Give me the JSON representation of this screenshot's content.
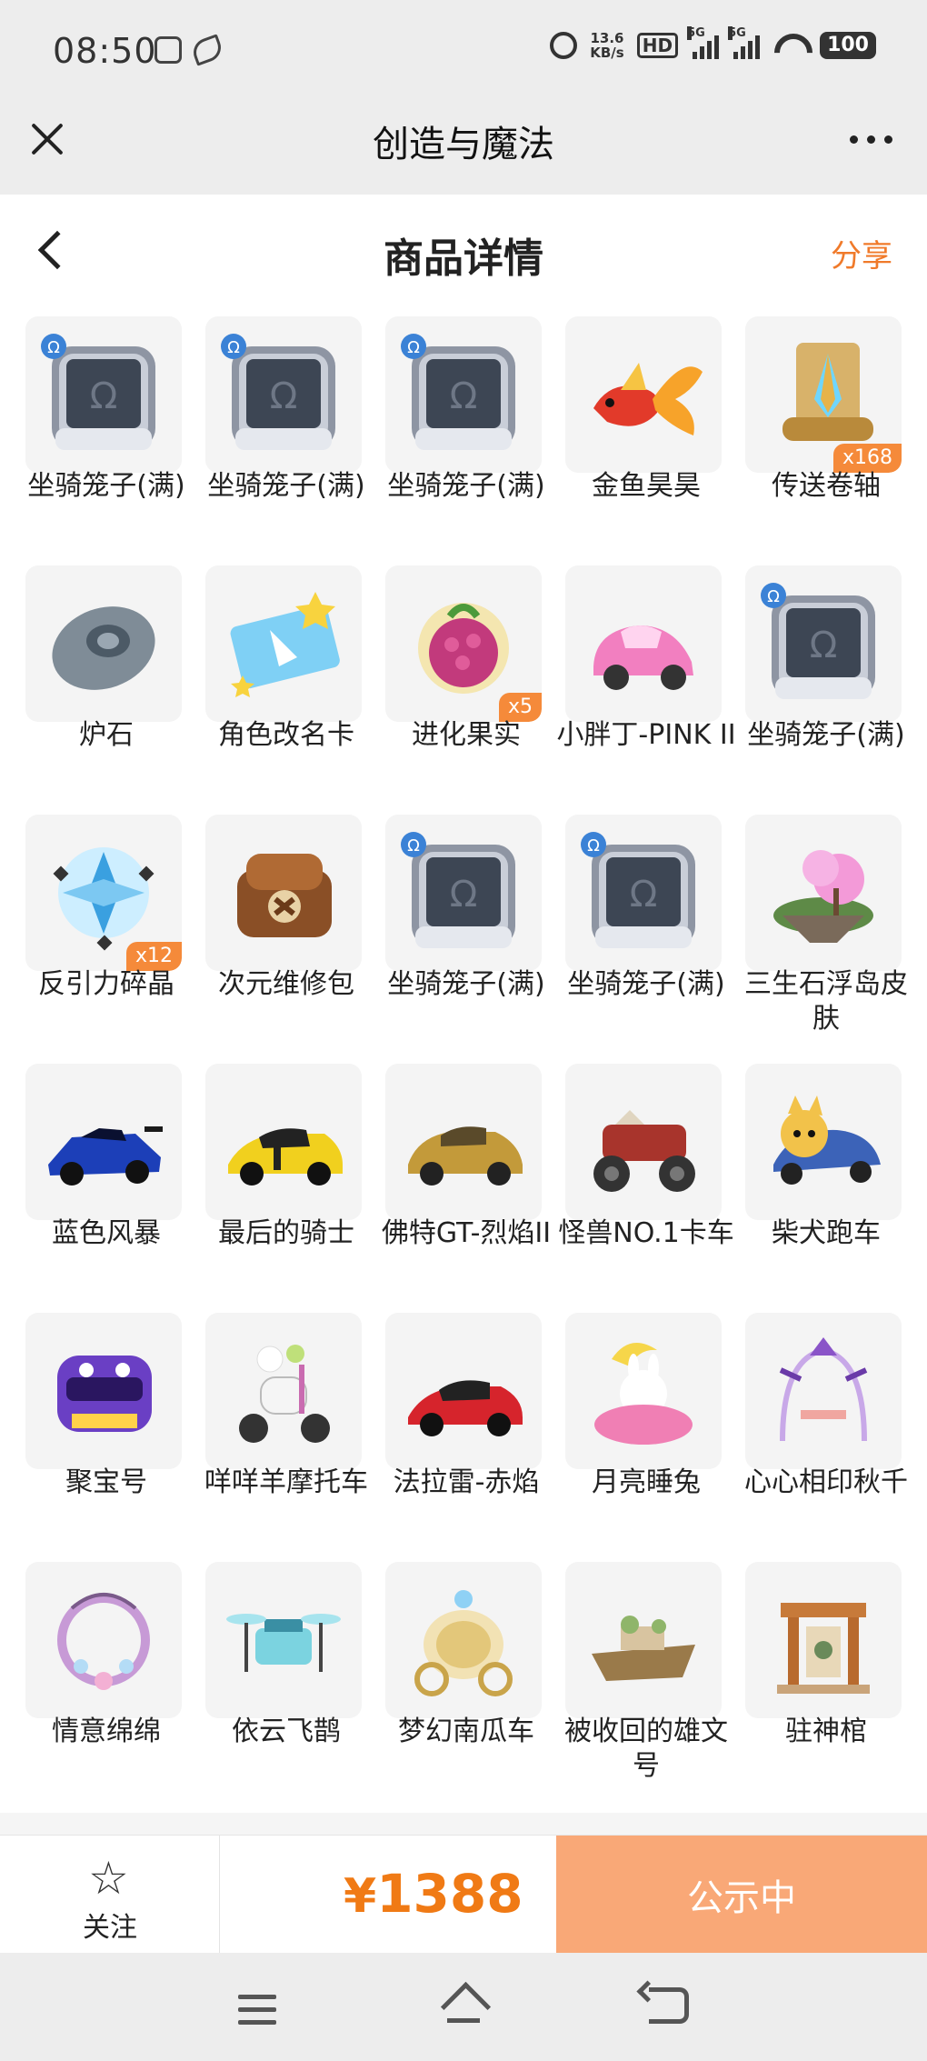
{
  "status_bar": {
    "time": "08:50",
    "speed_value": "13.6",
    "speed_unit": "KB/s",
    "hd_label": "HD",
    "net1": "5G",
    "net2": "5G",
    "battery": "100"
  },
  "app_bar": {
    "title": "创造与魔法",
    "close_icon": "close-icon",
    "more_icon": "more-icon"
  },
  "page_header": {
    "title": "商品详情",
    "share_label": "分享"
  },
  "items": [
    {
      "label": "坐骑笼子(满)",
      "icon": "cage",
      "badge": ""
    },
    {
      "label": "坐骑笼子(满)",
      "icon": "cage",
      "badge": ""
    },
    {
      "label": "坐骑笼子(满)",
      "icon": "cage",
      "badge": ""
    },
    {
      "label": "金鱼昊昊",
      "icon": "goldfish",
      "badge": ""
    },
    {
      "label": "传送卷轴",
      "icon": "scroll",
      "badge": "x168"
    },
    {
      "label": "炉石",
      "icon": "hearthstone",
      "badge": ""
    },
    {
      "label": "角色改名卡",
      "icon": "rename-card",
      "badge": ""
    },
    {
      "label": "进化果实",
      "icon": "berry",
      "badge": "x5"
    },
    {
      "label": "小胖丁-PINK II",
      "icon": "pink-car",
      "badge": ""
    },
    {
      "label": "坐骑笼子(满)",
      "icon": "cage",
      "badge": ""
    },
    {
      "label": "反引力碎晶",
      "icon": "crystal",
      "badge": "x12"
    },
    {
      "label": "次元维修包",
      "icon": "repair-bag",
      "badge": ""
    },
    {
      "label": "坐骑笼子(满)",
      "icon": "cage",
      "badge": ""
    },
    {
      "label": "坐骑笼子(满)",
      "icon": "cage",
      "badge": ""
    },
    {
      "label": "三生石浮岛皮肤",
      "icon": "island",
      "badge": ""
    },
    {
      "label": "蓝色风暴",
      "icon": "blue-car",
      "badge": ""
    },
    {
      "label": "最后的骑士",
      "icon": "yellow-car",
      "badge": ""
    },
    {
      "label": "佛特GT-烈焰II",
      "icon": "gt-car",
      "badge": ""
    },
    {
      "label": "怪兽NO.1卡车",
      "icon": "monster-truck",
      "badge": ""
    },
    {
      "label": "柴犬跑车",
      "icon": "dog-car",
      "badge": ""
    },
    {
      "label": "聚宝号",
      "icon": "purple-vehicle",
      "badge": ""
    },
    {
      "label": "咩咩羊摩托车",
      "icon": "sheep-scooter",
      "badge": ""
    },
    {
      "label": "法拉雷-赤焰",
      "icon": "red-car",
      "badge": ""
    },
    {
      "label": "月亮睡兔",
      "icon": "moon-rabbit",
      "badge": ""
    },
    {
      "label": "心心相印秋千",
      "icon": "swing",
      "badge": ""
    },
    {
      "label": "情意绵绵",
      "icon": "wreath",
      "badge": ""
    },
    {
      "label": "依云飞鹊",
      "icon": "drone",
      "badge": ""
    },
    {
      "label": "梦幻南瓜车",
      "icon": "carriage",
      "badge": ""
    },
    {
      "label": "被收回的雄文号",
      "icon": "boat",
      "badge": ""
    },
    {
      "label": "驻神棺",
      "icon": "shrine",
      "badge": ""
    }
  ],
  "footer": {
    "follow_label": "关注",
    "price_symbol": "¥",
    "price_value": "1388",
    "status_label": "公示中"
  },
  "colors": {
    "accent": "#f07a2a",
    "button": "#f9a877",
    "badge": "#f58a3a"
  }
}
